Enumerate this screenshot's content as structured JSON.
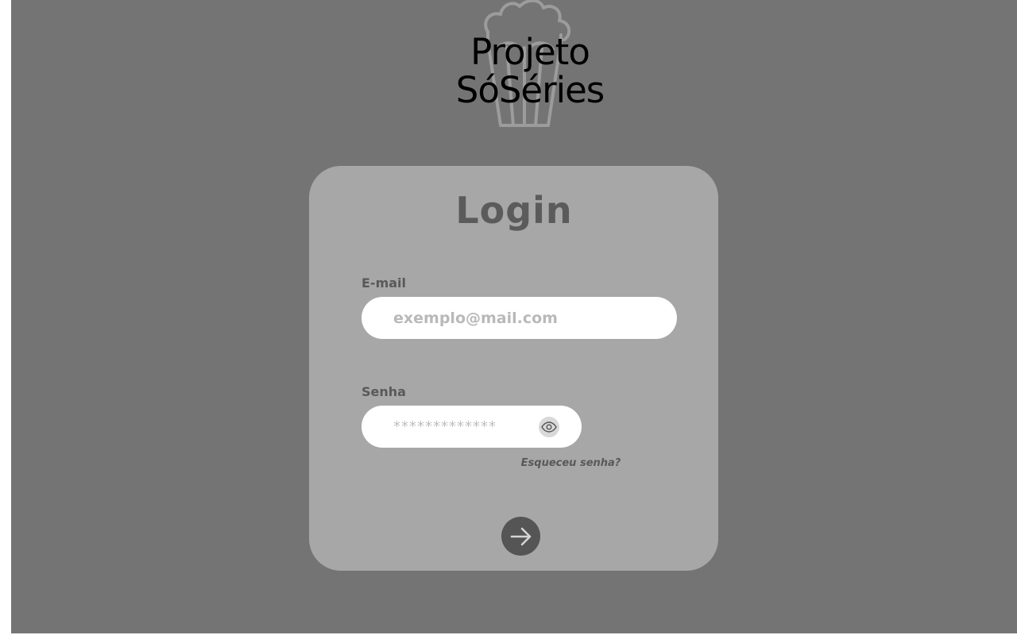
{
  "logo": {
    "line1": "Projeto",
    "line2": "SóSéries",
    "icon": "popcorn-icon"
  },
  "login": {
    "title": "Login",
    "email": {
      "label": "E-mail",
      "placeholder": "exemplo@mail.com",
      "value": ""
    },
    "password": {
      "label": "Senha",
      "masked_value": "*************",
      "toggle_icon": "eye-icon"
    },
    "forgot_link": "Esqueceu senha?",
    "submit_icon": "arrow-right-icon"
  },
  "colors": {
    "background": "#747474",
    "card": "#a7a7a7",
    "label_text": "#595959",
    "submit_button": "#555555"
  }
}
